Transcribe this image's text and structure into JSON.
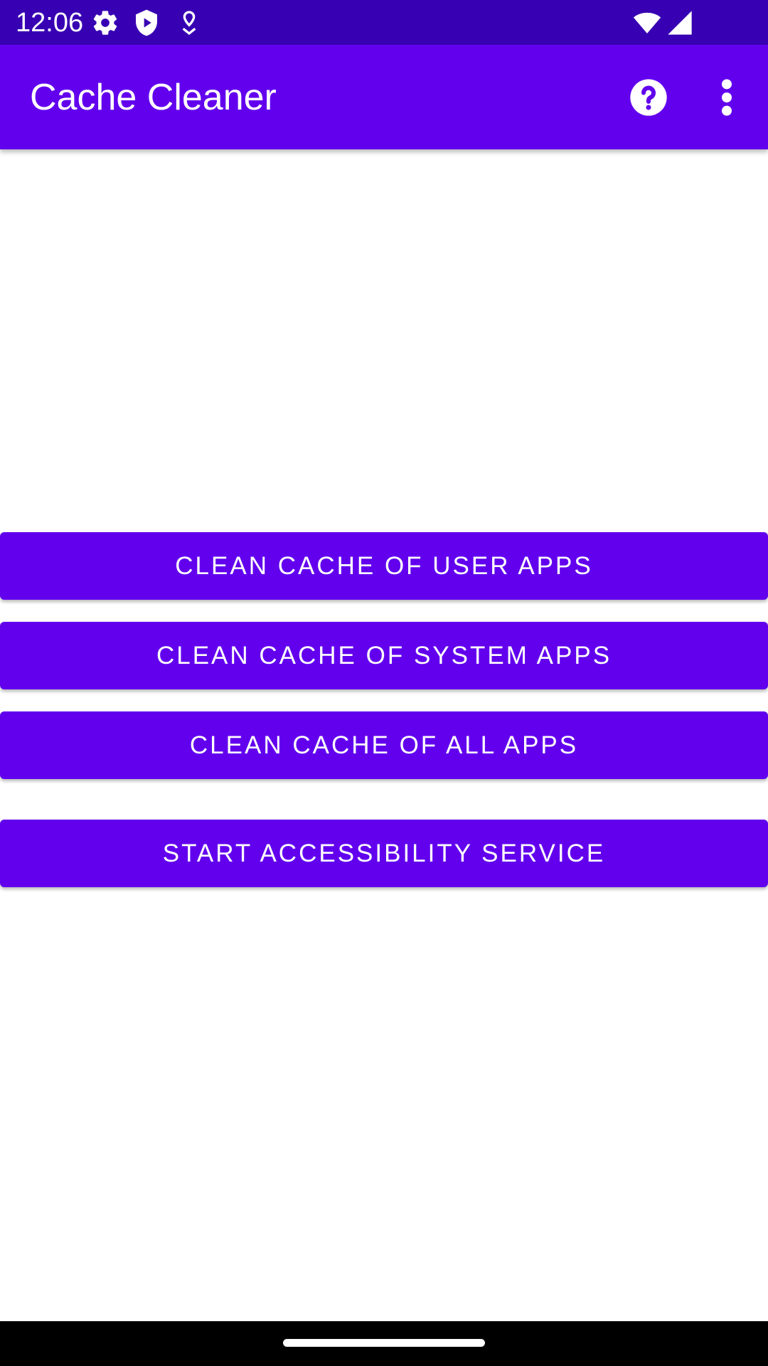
{
  "status_bar": {
    "time": "12:06",
    "icons": [
      "gear-icon",
      "shield-play-icon",
      "location-pin-icon",
      "wifi-icon",
      "signal-icon"
    ]
  },
  "app_bar": {
    "title": "Cache Cleaner",
    "actions": [
      "help-icon",
      "overflow-menu-icon"
    ]
  },
  "buttons": {
    "clean_user": "CLEAN CACHE OF USER APPS",
    "clean_system": "CLEAN CACHE OF SYSTEM APPS",
    "clean_all": "CLEAN CACHE OF ALL APPS",
    "start_service": "START ACCESSIBILITY SERVICE"
  },
  "colors": {
    "status_bar": "#3700b3",
    "primary": "#6200ee",
    "on_primary": "#ffffff",
    "background": "#ffffff",
    "nav_bar": "#000000"
  }
}
